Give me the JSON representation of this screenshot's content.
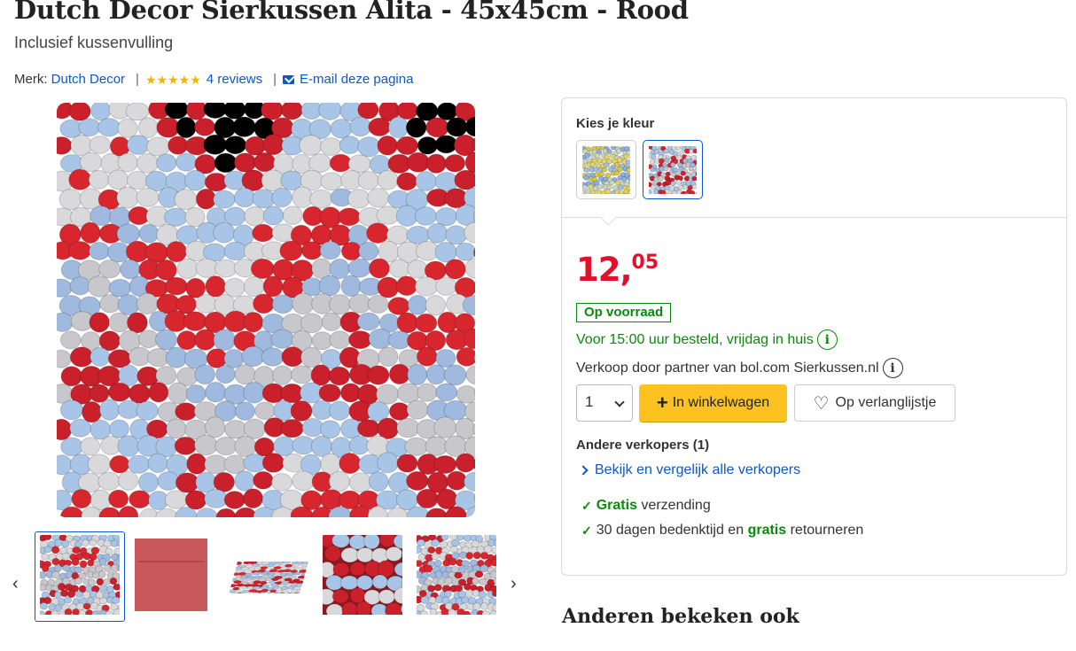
{
  "product": {
    "title": "Dutch Decor Sierkussen Alita - 45x45cm - Rood",
    "subtitle": "Inclusief kussenvulling",
    "brand_label": "Merk:",
    "brand": "Dutch Decor",
    "rating": 5,
    "reviews": "4 reviews",
    "email_page": "E-mail deze pagina"
  },
  "gallery": {
    "prev": "‹",
    "next": "›",
    "thumbnail_count": 5,
    "active_index": 0
  },
  "buybox": {
    "color_label": "Kies je kleur",
    "swatches": [
      "multicolor-yellow-blue",
      "red-blue-white"
    ],
    "selected_swatch": 1,
    "price_int": "12,",
    "price_dec": "05",
    "stock": "Op voorraad",
    "delivery": "Voor 15:00 uur besteld, vrijdag in huis",
    "seller": "Verkoop door partner van bol.com Sierkussen.nl",
    "quantity": "1",
    "cart_button": "In winkelwagen",
    "wishlist_button": "Op verlanglijstje",
    "other_sellers": "Andere verkopers (1)",
    "compare_link": "Bekijk en vergelijk alle verkopers",
    "usp1_green": "Gratis",
    "usp1_rest": "verzending",
    "usp2_pre": "30 dagen bedenktijd en",
    "usp2_green": "gratis",
    "usp2_rest": "retourneren"
  },
  "section_also_viewed": "Anderen bekeken ook",
  "colors": {
    "accent_blue": "#0a58ca",
    "price_red": "#e0112b",
    "stock_green": "#0a8a0a",
    "cart_yellow": "#fcc21f",
    "star_gold": "#f4b400"
  }
}
